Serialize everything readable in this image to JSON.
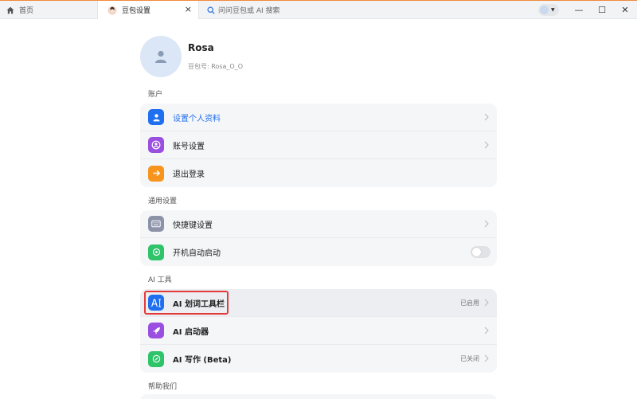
{
  "tabs": {
    "home_label": "首页",
    "settings_label": "豆包设置",
    "search_label": "问问豆包或 AI 搜索",
    "close_glyph": "×"
  },
  "window_controls": {
    "minimize": "—",
    "maximize": "☐",
    "close": "✕"
  },
  "profile": {
    "name": "Rosa",
    "id_text": "豆包号: Rosa_O_O"
  },
  "sections": {
    "account": "账户",
    "general": "通用设置",
    "ai_tools": "AI 工具",
    "help": "帮助我们"
  },
  "account_items": [
    "设置个人资料",
    "账号设置",
    "退出登录"
  ],
  "general_items": [
    "快捷键设置",
    "开机自动启动"
  ],
  "ai_items": [
    {
      "label": "AI 划词工具栏",
      "status": "已启用"
    },
    {
      "label": "AI 启动器",
      "status": ""
    },
    {
      "label": "AI 写作 (Beta)",
      "status": "已关闭"
    }
  ],
  "toggles": {
    "autostart": false
  },
  "colors": {
    "accent_blue": "#1f6ff0",
    "purple": "#9a4fe0",
    "orange": "#f7941d",
    "gray_blue": "#8c93a8",
    "green": "#2fc36a",
    "highlight_red": "#e33b3b"
  },
  "icons": {
    "profile": "user-icon",
    "account_settings": "account-circle-icon",
    "logout": "arrow-right-icon",
    "shortcut": "keyboard-icon",
    "autostart": "power-icon",
    "ai_toolbar": "text-cursor-icon",
    "ai_launcher": "rocket-icon",
    "ai_writing": "pen-icon"
  }
}
